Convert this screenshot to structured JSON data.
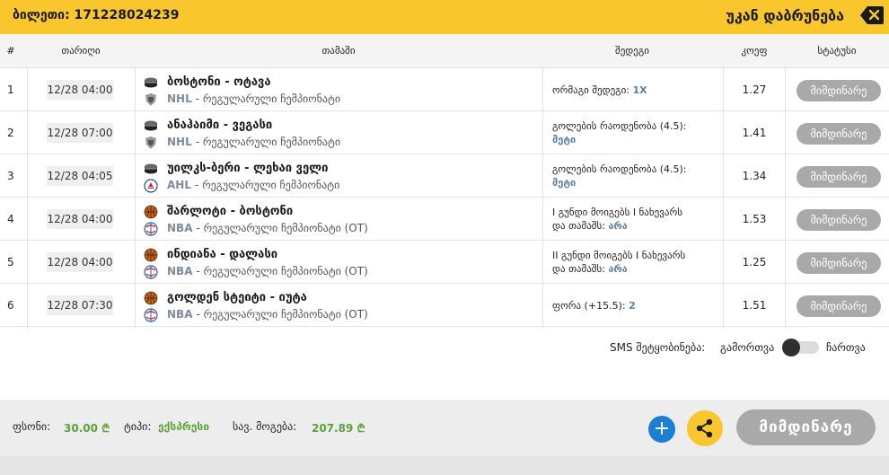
{
  "header": {
    "ticket_label": "ბილეთი: 171228024239",
    "back_label": "უკან დაბრუნება"
  },
  "columns": {
    "num": "#",
    "date": "თარიღი",
    "game": "თამაში",
    "result": "შედეგი",
    "coef": "კოეფ",
    "status": "სტატუსი"
  },
  "rows": [
    {
      "num": "1",
      "date": "12/28 04:00",
      "match": "ბოსტონი - ოტავა",
      "league": "NHL",
      "league_desc": "- რეგულარული ჩემპიონატი",
      "sport_icon": "hockey-puck-icon",
      "league_icon": "nhl-logo-icon",
      "result_line1": "ორმაგი შედეგი: ",
      "result_line2": "",
      "result_value": "1X",
      "coef": "1.27",
      "status": "მიმდინარე"
    },
    {
      "num": "2",
      "date": "12/28 07:00",
      "match": "ანაჰაიმი - ვეგასი",
      "league": "NHL",
      "league_desc": "- რეგულარული ჩემპიონატი",
      "sport_icon": "hockey-puck-icon",
      "league_icon": "nhl-logo-icon",
      "result_line1": "გოლების რაოდენობა (4.5):",
      "result_line2": "",
      "result_value": "მეტი",
      "coef": "1.41",
      "status": "მიმდინარე"
    },
    {
      "num": "3",
      "date": "12/28 04:05",
      "match": "უილკს-ბერი - ლეხაი ველი",
      "league": "AHL",
      "league_desc": "- რეგულარული ჩემპიონატი",
      "sport_icon": "hockey-puck-icon",
      "league_icon": "ahl-logo-icon",
      "result_line1": "გოლების რაოდენობა (4.5):",
      "result_line2": "",
      "result_value": "მეტი",
      "coef": "1.34",
      "status": "მიმდინარე"
    },
    {
      "num": "4",
      "date": "12/28 04:00",
      "match": "შარლოტი - ბოსტონი",
      "league": "NBA",
      "league_desc": "- რეგულარული ჩემპიონატი (OT)",
      "sport_icon": "basketball-icon",
      "league_icon": "nba-logo-icon",
      "result_line1": "I გუნდი მოიგებს I ნახევარს",
      "result_line2": "და თამაშს: ",
      "result_value": "არა",
      "coef": "1.53",
      "status": "მიმდინარე"
    },
    {
      "num": "5",
      "date": "12/28 04:00",
      "match": "ინდიანა - დალასი",
      "league": "NBA",
      "league_desc": "- რეგულარული ჩემპიონატი (OT)",
      "sport_icon": "basketball-icon",
      "league_icon": "nba-logo-icon",
      "result_line1": "II გუნდი მოიგებს I ნახევარს",
      "result_line2": "და თამაშს: ",
      "result_value": "არა",
      "coef": "1.25",
      "status": "მიმდინარე"
    },
    {
      "num": "6",
      "date": "12/28 07:30",
      "match": "გოლდენ სტეიტი - იუტა",
      "league": "NBA",
      "league_desc": "- რეგულარული ჩემპიონატი (OT)",
      "sport_icon": "basketball-icon",
      "league_icon": "nba-logo-icon",
      "result_line1": "ფორა (+15.5): ",
      "result_line2": "",
      "result_value": "2",
      "coef": "1.51",
      "status": "მიმდინარე"
    }
  ],
  "sms": {
    "label": "SMS შეტყობინება:",
    "off_label": "გამორთვა",
    "on_label": "ჩართვა"
  },
  "footer": {
    "stake_label": "ფსონი:",
    "stake_value": "30.00",
    "currency_symbol": "₾",
    "type_label": "ტიპი:",
    "type_value": "ექსპრესი",
    "potential_label": "სავ. მოგება:",
    "potential_value": "207.89",
    "plus_symbol": "+",
    "status_button": "მიმდინარე"
  },
  "colors": {
    "accent": "#f9c62e",
    "link": "#5a7ea8",
    "value_green": "#5aa43a",
    "status_gray": "#a9a9a9",
    "plus_blue": "#1c7fd4"
  }
}
